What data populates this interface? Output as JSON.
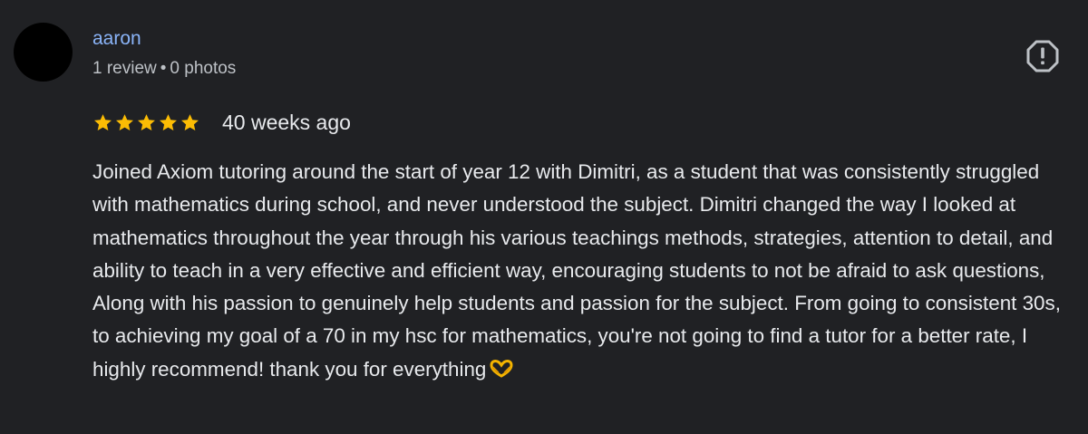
{
  "review": {
    "author_name": "aaron",
    "review_count": "1 review",
    "separator": "•",
    "photo_count": "0 photos",
    "rating": 5,
    "max_rating": 5,
    "date": "40 weeks ago",
    "text": "Joined Axiom tutoring around the start of year 12 with Dimitri, as a student that was consistently struggled with mathematics during school, and never understood the subject. Dimitri changed the way I looked at mathematics throughout the year through his various teachings methods, strategies, attention to detail, and ability to teach in a very effective and efficient way, encouraging students to not be afraid to ask questions, Along with his passion to genuinely help students and passion for the subject. From going to consistent 30s, to achieving my goal of a 70 in my hsc for mathematics, you're not going to find a tutor for a better rate, I highly recommend! thank you for everything",
    "trailing_emoji": "heart-hands-emoji"
  },
  "icons": {
    "report": "report-flag-icon",
    "star": "star-icon"
  },
  "colors": {
    "background": "#202124",
    "author_link": "#8ab4f8",
    "star": "#fbbc04",
    "text_primary": "#e8eaed",
    "text_secondary": "#bdc1c6",
    "avatar": "#000000"
  }
}
